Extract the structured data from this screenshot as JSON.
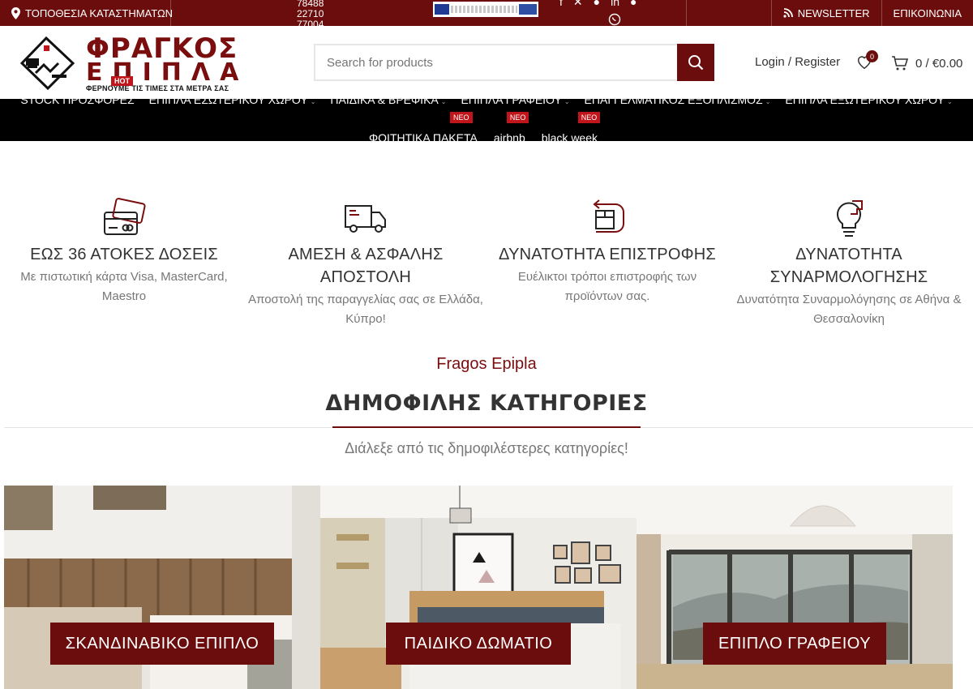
{
  "topbar": {
    "store_locations": "ΤΟΠΟΘΕΣΙΑ ΚΑΤΑΣΤΗΜΑΤΩΝ",
    "phone_lines": [
      "78488",
      "22710",
      "77004"
    ],
    "newsletter": "NEWSLETTER",
    "contact": "ΕΠΙΚΟΙΝΩΝΙΑ",
    "social_icons": [
      "facebook-icon",
      "x-icon",
      "pinterest-icon",
      "linkedin-icon",
      "telegram-icon",
      "viber-icon"
    ]
  },
  "header": {
    "brand_line1": "ΦΡΑΓΚΟΣ",
    "brand_line2": "ΕΠΙΠΛΑ",
    "brand_tagline": "ΦΕΡΝΟΥΜΕ ΤΙΣ ΤΙΜΕΣ ΣΤΑ ΜΕΤΡΑ ΣΑΣ",
    "hot_badge": "HOT",
    "search_placeholder": "Search for products",
    "account": "Login / Register",
    "wishlist_count": "0",
    "cart_total": "0 / €0.00"
  },
  "nav": {
    "items": [
      {
        "label": "STOCK ΠΡΟΣΦΟΡΕΣ",
        "has_dropdown": false
      },
      {
        "label": "ΕΠΙΠΛΑ ΕΣΩΤΕΡΙΚΟΥ ΧΩΡΟΥ",
        "has_dropdown": true
      },
      {
        "label": "ΠΑΙΔΙΚΑ & ΒΡΕΦΙΚΑ",
        "has_dropdown": true
      },
      {
        "label": "ΕΠΙΠΛΑ ΓΡΑΦΕΙΟΥ",
        "has_dropdown": true
      },
      {
        "label": "ΕΠΑΓΓΕΛΜΑΤΙΚΟΣ ΕΞΟΠΛΙΣΜΟΣ",
        "has_dropdown": true
      },
      {
        "label": "ΕΠΙΠΛΑ ΕΞΩΤΕΡΙΚΟΥ ΧΩΡΟΥ",
        "has_dropdown": true
      }
    ],
    "items2": [
      {
        "label": "ΦΟΙΤΗΤΙΚΑ ΠΑΚΕΤΑ",
        "badge": "ΝΕΟ"
      },
      {
        "label": "airbnb",
        "badge": "ΝΕΟ"
      },
      {
        "label": "black week",
        "badge": "ΝΕΟ"
      }
    ]
  },
  "features": [
    {
      "icon": "credit-card-icon",
      "title": "ΕΩΣ 36 ΑΤΟΚΕΣ ΔΟΣΕΙΣ",
      "desc": "Με πιστωτική κάρτα Visa, MasterCard, Maestro"
    },
    {
      "icon": "delivery-truck-icon",
      "title": "ΑΜΕΣΗ & ΑΣΦΑΛΗΣ ΑΠΟΣΤΟΛΗ",
      "desc": "Αποστολή της παραγγελίας σας σε Ελλάδα, Κύπρο!"
    },
    {
      "icon": "return-box-icon",
      "title": "ΔΥΝΑΤΟΤΗΤΑ ΕΠΙΣΤΡΟΦΗΣ",
      "desc": "Ευέλικτοι τρόποι επιστροφής των προϊόντων σας."
    },
    {
      "icon": "assembly-bulb-icon",
      "title": "ΔΥΝΑΤΟΤΗΤΑ ΣΥΝΑΡΜΟΛΟΓΗΣΗΣ",
      "desc": "Δυνατότητα Συναρμολόγησης σε Αθήνα & Θεσσαλονίκη"
    }
  ],
  "section": {
    "brand": "Fragos Epipla",
    "title": "ΔΗΜΟΦΙΛΗΣ ΚΑΤΗΓΟΡΙΕΣ",
    "subtitle": "Διάλεξε από τις δημοφιλέστερες κατηγορίες!"
  },
  "categories": [
    {
      "label": "ΣΚΑΝΔΙΝΑΒΙΚΟ ΕΠΙΠΛΟ"
    },
    {
      "label": "ΠΑΙΔΙΚΟ ΔΩΜΑΤΙΟ"
    },
    {
      "label": "ΕΠΙΠΛΟ ΓΡΑΦΕΙΟΥ"
    }
  ],
  "colors": {
    "brand": "#6b0d0d",
    "badge": "#c0161b",
    "nav_bg": "#000000"
  }
}
